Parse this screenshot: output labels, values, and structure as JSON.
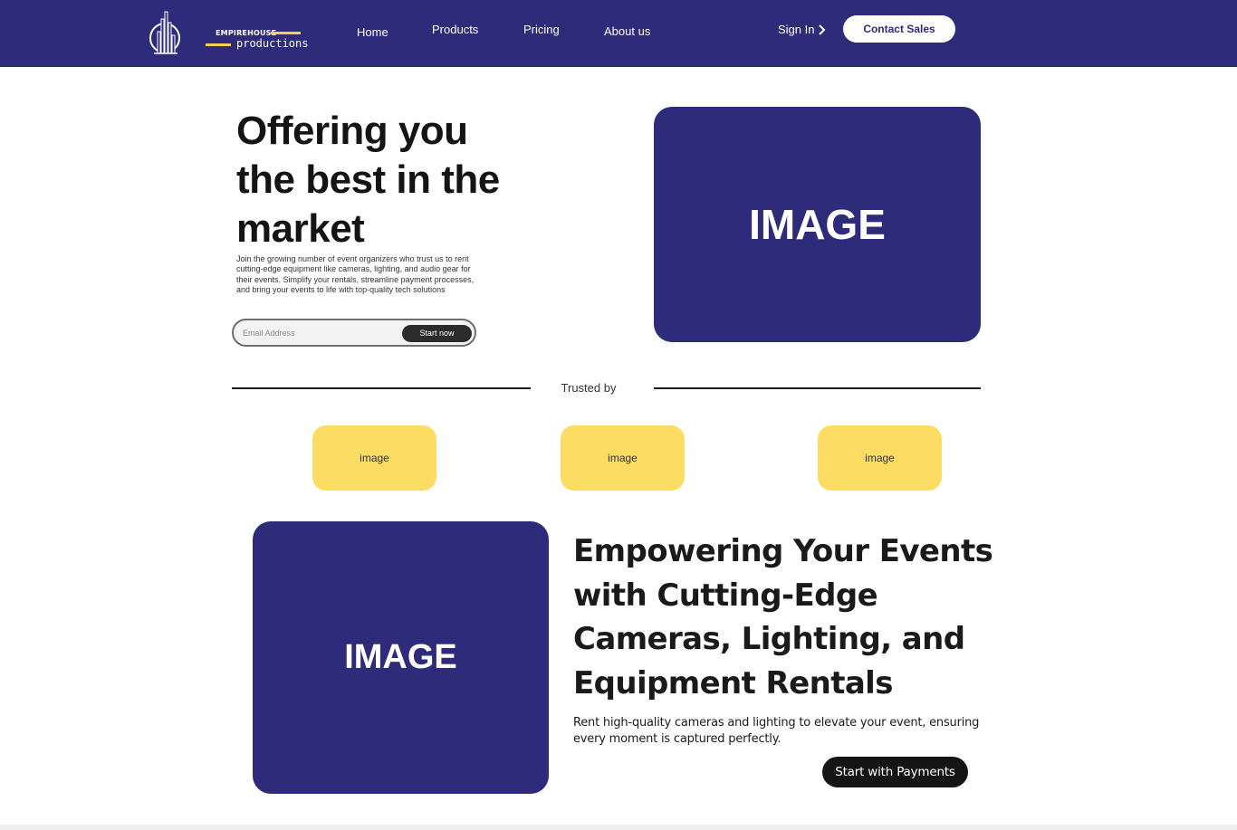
{
  "brand": {
    "top": "EMPIREHOUSE",
    "bottom": "productions",
    "accent": "#f7cf4d",
    "primary": "#2e2b7a"
  },
  "nav": {
    "links": [
      "Home",
      "Products",
      "Pricing",
      "About us"
    ],
    "signin": "Sign In",
    "signin_icon": "chevron-right-icon",
    "contact": "Contact Sales"
  },
  "hero": {
    "title": "Offering you the best in the market",
    "description": "Join the growing number of event organizers who trust us to rent cutting-edge equipment like cameras, lighting, and audio gear for their events. Simplify your rentals, streamline payment processes, and bring your events to life with top-quality tech solutions",
    "email_placeholder": "Email Address",
    "start_label": "Start now",
    "image_label": "IMAGE"
  },
  "trusted": {
    "label": "Trusted by",
    "logos": [
      "image",
      "image",
      "image"
    ],
    "logo_color": "#fddc64"
  },
  "section2": {
    "image_label": "IMAGE",
    "title": "Empowering Your Events with Cutting-Edge Cameras, Lighting, and Equipment Rentals",
    "description": "Rent high-quality cameras and lighting to elevate your event, ensuring every moment is captured perfectly.",
    "button": "Start with Payments"
  }
}
